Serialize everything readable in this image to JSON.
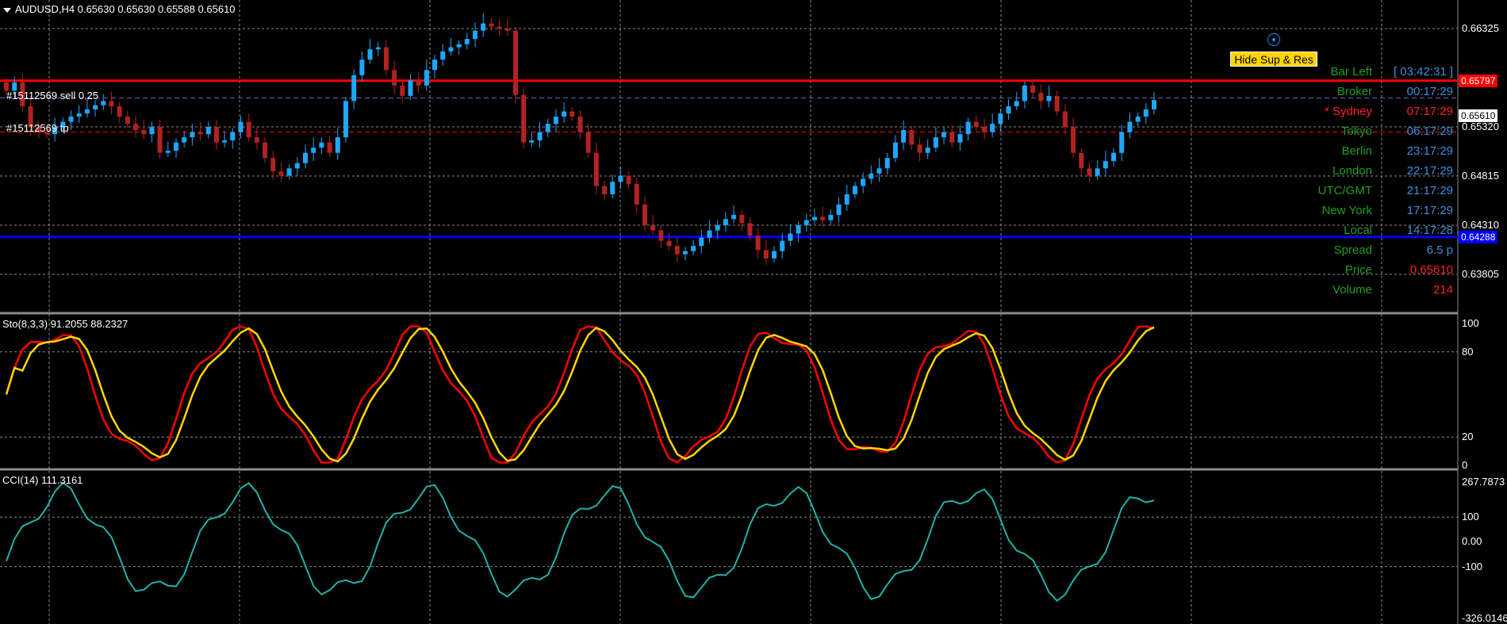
{
  "header": {
    "symbol_title": "AUDUSD,H4  0.65630 0.65630 0.65588 0.65610"
  },
  "orders": {
    "sell_label": "#15112569 sell 0.25",
    "tp_label": "#15112569 tp"
  },
  "controls": {
    "hide_button_label": "Hide Sup & Res"
  },
  "info_panel": [
    {
      "label": "Bar Left",
      "value": "[ 03:42:31 ]",
      "label_color": "#1e9e1e",
      "value_color": "#3b8edb"
    },
    {
      "label": "Broker",
      "value": "00:17:29",
      "label_color": "#1e9e1e",
      "value_color": "#3b8edb"
    },
    {
      "label": "* Sydney",
      "value": "07:17:29",
      "label_color": "#ff2020",
      "value_color": "#ff2020"
    },
    {
      "label": "Tokyo",
      "value": "06:17:29",
      "label_color": "#1e9e1e",
      "value_color": "#3b8edb"
    },
    {
      "label": "Berlin",
      "value": "23:17:29",
      "label_color": "#1e9e1e",
      "value_color": "#3b8edb"
    },
    {
      "label": "London",
      "value": "22:17:29",
      "label_color": "#1e9e1e",
      "value_color": "#3b8edb"
    },
    {
      "label": "UTC/GMT",
      "value": "21:17:29",
      "label_color": "#1e9e1e",
      "value_color": "#3b8edb"
    },
    {
      "label": "New York",
      "value": "17:17:29",
      "label_color": "#1e9e1e",
      "value_color": "#3b8edb"
    },
    {
      "label": "Local",
      "value": "14:17:28",
      "label_color": "#1e9e1e",
      "value_color": "#3b8edb"
    },
    {
      "label": "Spread",
      "value": "6.5 p",
      "label_color": "#1e9e1e",
      "value_color": "#3b8edb"
    },
    {
      "label": "Price",
      "value": "0.65610",
      "label_color": "#1e9e1e",
      "value_color": "#ff2020"
    },
    {
      "label": "Volume",
      "value": "214",
      "label_color": "#1e9e1e",
      "value_color": "#ff2020"
    }
  ],
  "price_axis": {
    "labels": [
      "0.66325",
      "0.65320",
      "0.64815",
      "0.64310",
      "0.63805"
    ],
    "resistance_tag": "0.65797",
    "current_tag": "0.65610",
    "support_tag": "0.64288"
  },
  "stochastic": {
    "title": "Sto(8,3,3) 91.2055 88.2327",
    "levels": [
      "100",
      "80",
      "20",
      "0"
    ]
  },
  "cci": {
    "title": "CCI(14) 111.3161",
    "levels": [
      "267.7873",
      "100",
      "0.00",
      "-100",
      "-326.0146"
    ]
  },
  "colors": {
    "bull": "#1ea7ff",
    "bear": "#b22222",
    "resistance": "#ff0000",
    "support": "#0000ff",
    "sto_main": "#ff0000",
    "sto_signal": "#ffd700",
    "cci_line": "#20b2aa",
    "grid": "#8a8a8a"
  },
  "chart_data": {
    "type": "candlestick",
    "symbol": "AUDUSD",
    "timeframe": "H4",
    "ylim": [
      0.6365,
      0.665
    ],
    "resistance_level": 0.65797,
    "support_level": 0.64288,
    "sell_order_price": 0.6563,
    "tp_price": 0.653,
    "closes": [
      0.657,
      0.6578,
      0.6555,
      0.6535,
      0.653,
      0.6528,
      0.6535,
      0.654,
      0.6545,
      0.6548,
      0.6552,
      0.6556,
      0.656,
      0.6555,
      0.6545,
      0.6538,
      0.6532,
      0.6528,
      0.6535,
      0.651,
      0.6512,
      0.652,
      0.6525,
      0.653,
      0.6528,
      0.6535,
      0.652,
      0.6522,
      0.653,
      0.654,
      0.6525,
      0.652,
      0.6505,
      0.6492,
      0.6488,
      0.6495,
      0.65,
      0.651,
      0.6515,
      0.652,
      0.651,
      0.6525,
      0.656,
      0.6585,
      0.66,
      0.661,
      0.6612,
      0.659,
      0.6575,
      0.6565,
      0.658,
      0.6575,
      0.659,
      0.66,
      0.6608,
      0.6612,
      0.6615,
      0.662,
      0.6628,
      0.6635,
      0.6632,
      0.663,
      0.6628,
      0.6566,
      0.652,
      0.6522,
      0.653,
      0.6538,
      0.6545,
      0.655,
      0.6545,
      0.653,
      0.651,
      0.6478,
      0.647,
      0.6482,
      0.6488,
      0.648,
      0.646,
      0.644,
      0.6435,
      0.6425,
      0.642,
      0.6412,
      0.6415,
      0.642,
      0.6428,
      0.6435,
      0.644,
      0.6446,
      0.645,
      0.6442,
      0.643,
      0.6416,
      0.6408,
      0.6415,
      0.6425,
      0.6432,
      0.644,
      0.6445,
      0.6448,
      0.6445,
      0.645,
      0.646,
      0.647,
      0.6478,
      0.6485,
      0.649,
      0.6495,
      0.6505,
      0.652,
      0.6532,
      0.6518,
      0.651,
      0.6515,
      0.6525,
      0.653,
      0.652,
      0.6528,
      0.654,
      0.6535,
      0.653,
      0.6538,
      0.6548,
      0.6555,
      0.656,
      0.6575,
      0.6568,
      0.656,
      0.6565,
      0.655,
      0.6535,
      0.651,
      0.6495,
      0.6488,
      0.6495,
      0.6502,
      0.651,
      0.653,
      0.654,
      0.6545,
      0.6552,
      0.6561
    ]
  }
}
